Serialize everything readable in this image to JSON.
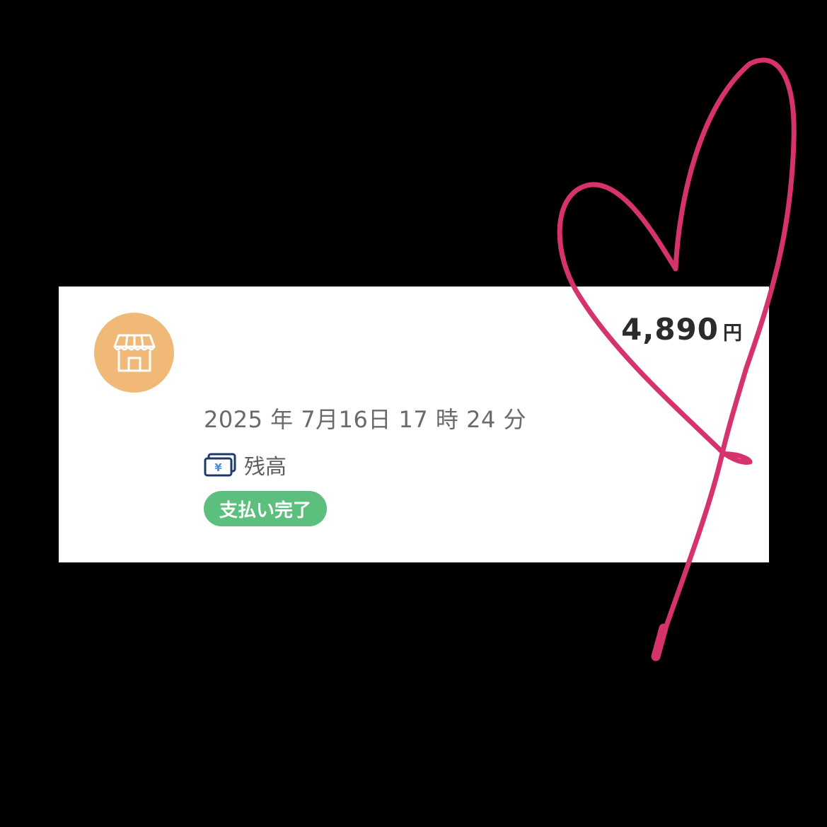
{
  "transaction": {
    "merchant_icon": "store-icon",
    "amount_value": "4,890",
    "amount_unit": "円",
    "datetime": "2025 年 7月16日 17 時 24 分",
    "payment_method_icon": "yen-banknote-icon",
    "payment_method": "残高",
    "status": "支払い完了"
  },
  "colors": {
    "background": "#000000",
    "card": "#ffffff",
    "store_avatar": "#f0b978",
    "status_badge": "#5cbf7d",
    "heart_stroke": "#d6336c",
    "banknote_stroke": "#1e3a6b",
    "banknote_yen": "#4a90d9"
  },
  "decoration": {
    "overlay": "hand-drawn-heart"
  }
}
